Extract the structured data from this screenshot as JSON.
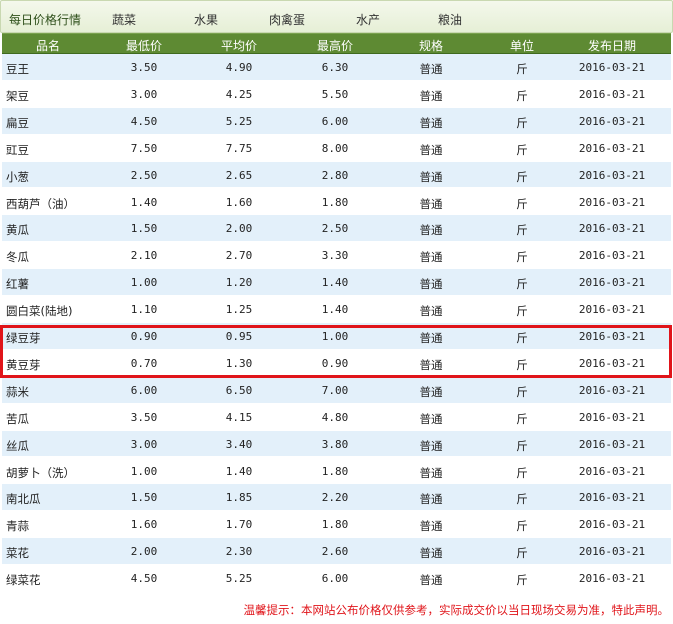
{
  "nav": {
    "title": "每日价格行情",
    "items": [
      "蔬菜",
      "水果",
      "肉禽蛋",
      "水产",
      "粮油"
    ]
  },
  "headers": [
    "品名",
    "最低价",
    "平均价",
    "最高价",
    "规格",
    "单位",
    "发布日期"
  ],
  "rows": [
    {
      "name": "豆王",
      "min": "3.50",
      "avg": "4.90",
      "max": "6.30",
      "spec": "普通",
      "unit": "斤",
      "date": "2016-03-21"
    },
    {
      "name": "架豆",
      "min": "3.00",
      "avg": "4.25",
      "max": "5.50",
      "spec": "普通",
      "unit": "斤",
      "date": "2016-03-21"
    },
    {
      "name": "扁豆",
      "min": "4.50",
      "avg": "5.25",
      "max": "6.00",
      "spec": "普通",
      "unit": "斤",
      "date": "2016-03-21"
    },
    {
      "name": "豇豆",
      "min": "7.50",
      "avg": "7.75",
      "max": "8.00",
      "spec": "普通",
      "unit": "斤",
      "date": "2016-03-21"
    },
    {
      "name": "小葱",
      "min": "2.50",
      "avg": "2.65",
      "max": "2.80",
      "spec": "普通",
      "unit": "斤",
      "date": "2016-03-21"
    },
    {
      "name": "西葫芦（油）",
      "min": "1.40",
      "avg": "1.60",
      "max": "1.80",
      "spec": "普通",
      "unit": "斤",
      "date": "2016-03-21"
    },
    {
      "name": "黄瓜",
      "min": "1.50",
      "avg": "2.00",
      "max": "2.50",
      "spec": "普通",
      "unit": "斤",
      "date": "2016-03-21"
    },
    {
      "name": "冬瓜",
      "min": "2.10",
      "avg": "2.70",
      "max": "3.30",
      "spec": "普通",
      "unit": "斤",
      "date": "2016-03-21"
    },
    {
      "name": "红薯",
      "min": "1.00",
      "avg": "1.20",
      "max": "1.40",
      "spec": "普通",
      "unit": "斤",
      "date": "2016-03-21"
    },
    {
      "name": "圆白菜(陆地)",
      "min": "1.10",
      "avg": "1.25",
      "max": "1.40",
      "spec": "普通",
      "unit": "斤",
      "date": "2016-03-21"
    },
    {
      "name": "绿豆芽",
      "min": "0.90",
      "avg": "0.95",
      "max": "1.00",
      "spec": "普通",
      "unit": "斤",
      "date": "2016-03-21"
    },
    {
      "name": "黄豆芽",
      "min": "0.70",
      "avg": "1.30",
      "max": "0.90",
      "spec": "普通",
      "unit": "斤",
      "date": "2016-03-21"
    },
    {
      "name": "蒜米",
      "min": "6.00",
      "avg": "6.50",
      "max": "7.00",
      "spec": "普通",
      "unit": "斤",
      "date": "2016-03-21"
    },
    {
      "name": "苦瓜",
      "min": "3.50",
      "avg": "4.15",
      "max": "4.80",
      "spec": "普通",
      "unit": "斤",
      "date": "2016-03-21"
    },
    {
      "name": "丝瓜",
      "min": "3.00",
      "avg": "3.40",
      "max": "3.80",
      "spec": "普通",
      "unit": "斤",
      "date": "2016-03-21"
    },
    {
      "name": "胡萝卜（洗）",
      "min": "1.00",
      "avg": "1.40",
      "max": "1.80",
      "spec": "普通",
      "unit": "斤",
      "date": "2016-03-21"
    },
    {
      "name": "南北瓜",
      "min": "1.50",
      "avg": "1.85",
      "max": "2.20",
      "spec": "普通",
      "unit": "斤",
      "date": "2016-03-21"
    },
    {
      "name": "青蒜",
      "min": "1.60",
      "avg": "1.70",
      "max": "1.80",
      "spec": "普通",
      "unit": "斤",
      "date": "2016-03-21"
    },
    {
      "name": "菜花",
      "min": "2.00",
      "avg": "2.30",
      "max": "2.60",
      "spec": "普通",
      "unit": "斤",
      "date": "2016-03-21"
    },
    {
      "name": "绿菜花",
      "min": "4.50",
      "avg": "5.25",
      "max": "6.00",
      "spec": "普通",
      "unit": "斤",
      "date": "2016-03-21"
    }
  ],
  "footer_note": "温馨提示：本网站公布价格仅供参考，实际成交价以当日现场交易为准，特此声明。",
  "colors": {
    "header_bg": "#5e8a33",
    "row_alt_bg": "#e3f0fa",
    "highlight_border": "#e0141a",
    "note_text": "#e0141a"
  }
}
